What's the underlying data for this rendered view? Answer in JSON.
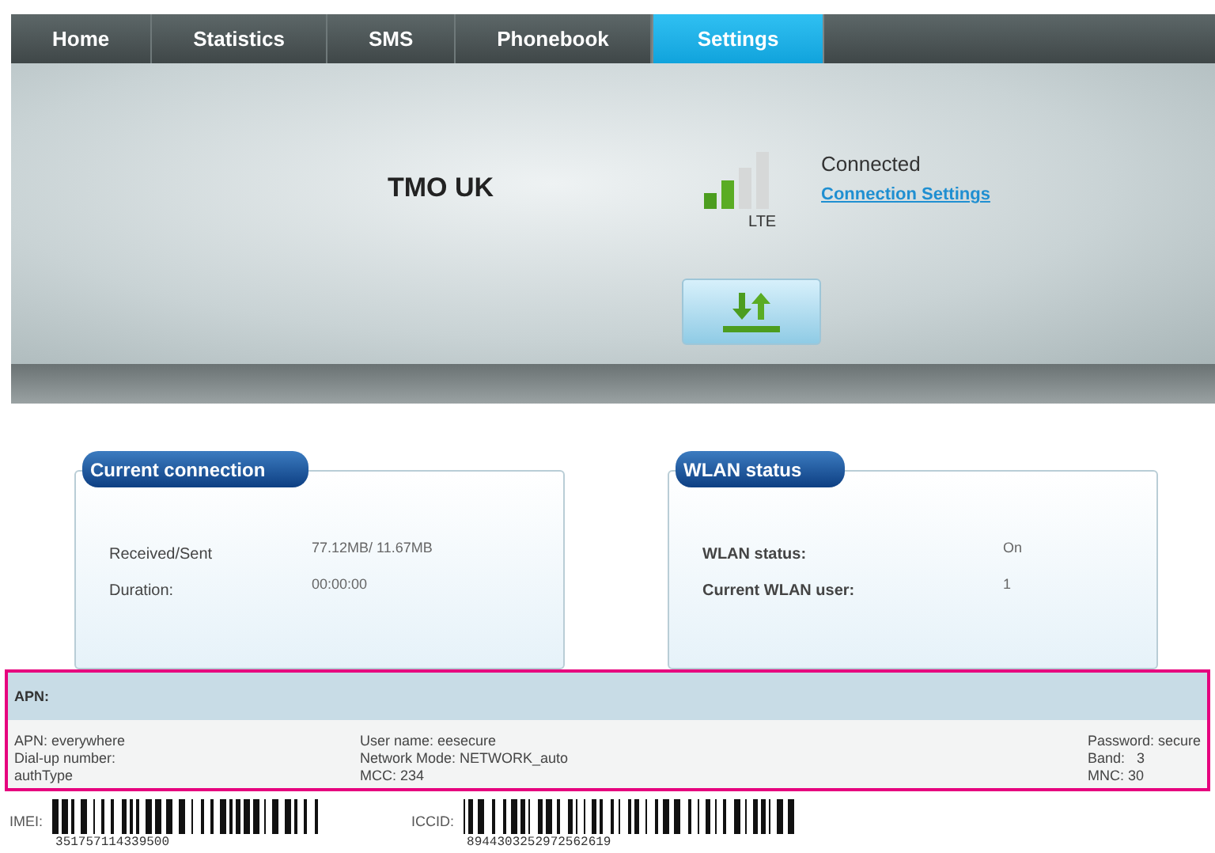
{
  "tabs": [
    {
      "label": "Home",
      "selected": false
    },
    {
      "label": "Statistics",
      "selected": false
    },
    {
      "label": "SMS",
      "selected": false
    },
    {
      "label": "Phonebook",
      "selected": false
    },
    {
      "label": "Settings",
      "selected": true
    }
  ],
  "network": {
    "operator": "TMO UK",
    "technology": "LTE",
    "status": "Connected",
    "link": "Connection Settings"
  },
  "cards": [
    {
      "title": "Current connection",
      "rows": [
        {
          "label": "Received/Sent",
          "value": "77.12MB/ 11.67MB"
        },
        {
          "label": "Duration:",
          "value": "00:00:00"
        }
      ]
    },
    {
      "title": "WLAN status",
      "rows": [
        {
          "label": "WLAN status:",
          "value": "On"
        },
        {
          "label": "Current WLAN user:",
          "value": "1"
        }
      ]
    }
  ],
  "apn": {
    "title": "APN:",
    "highlighted": true,
    "columns": [
      [
        "APN: everywhere",
        "Dial-up number:",
        "authType"
      ],
      [
        "User name: eesecure",
        "Network Mode: NETWORK_auto",
        "MCC: 234"
      ],
      [
        "Password: secure",
        "Band:   3",
        "MNC: 30"
      ]
    ]
  },
  "ids": [
    {
      "label": "IMEI:",
      "number": "351757114339500"
    },
    {
      "label": "ICCID:",
      "number": "8944303252972562619"
    }
  ]
}
